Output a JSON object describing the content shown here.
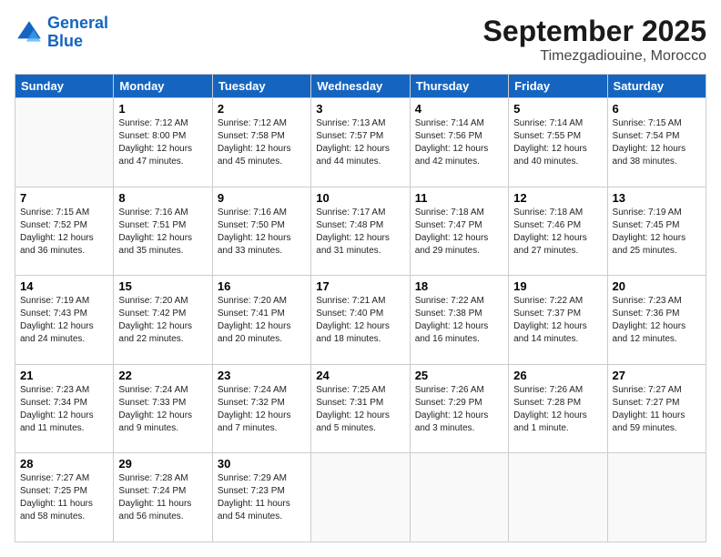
{
  "header": {
    "logo_line1": "General",
    "logo_line2": "Blue",
    "month": "September 2025",
    "location": "Timezgadiouine, Morocco"
  },
  "weekdays": [
    "Sunday",
    "Monday",
    "Tuesday",
    "Wednesday",
    "Thursday",
    "Friday",
    "Saturday"
  ],
  "weeks": [
    [
      {
        "day": "",
        "sunrise": "",
        "sunset": "",
        "daylight": ""
      },
      {
        "day": "1",
        "sunrise": "Sunrise: 7:12 AM",
        "sunset": "Sunset: 8:00 PM",
        "daylight": "Daylight: 12 hours and 47 minutes."
      },
      {
        "day": "2",
        "sunrise": "Sunrise: 7:12 AM",
        "sunset": "Sunset: 7:58 PM",
        "daylight": "Daylight: 12 hours and 45 minutes."
      },
      {
        "day": "3",
        "sunrise": "Sunrise: 7:13 AM",
        "sunset": "Sunset: 7:57 PM",
        "daylight": "Daylight: 12 hours and 44 minutes."
      },
      {
        "day": "4",
        "sunrise": "Sunrise: 7:14 AM",
        "sunset": "Sunset: 7:56 PM",
        "daylight": "Daylight: 12 hours and 42 minutes."
      },
      {
        "day": "5",
        "sunrise": "Sunrise: 7:14 AM",
        "sunset": "Sunset: 7:55 PM",
        "daylight": "Daylight: 12 hours and 40 minutes."
      },
      {
        "day": "6",
        "sunrise": "Sunrise: 7:15 AM",
        "sunset": "Sunset: 7:54 PM",
        "daylight": "Daylight: 12 hours and 38 minutes."
      }
    ],
    [
      {
        "day": "7",
        "sunrise": "Sunrise: 7:15 AM",
        "sunset": "Sunset: 7:52 PM",
        "daylight": "Daylight: 12 hours and 36 minutes."
      },
      {
        "day": "8",
        "sunrise": "Sunrise: 7:16 AM",
        "sunset": "Sunset: 7:51 PM",
        "daylight": "Daylight: 12 hours and 35 minutes."
      },
      {
        "day": "9",
        "sunrise": "Sunrise: 7:16 AM",
        "sunset": "Sunset: 7:50 PM",
        "daylight": "Daylight: 12 hours and 33 minutes."
      },
      {
        "day": "10",
        "sunrise": "Sunrise: 7:17 AM",
        "sunset": "Sunset: 7:48 PM",
        "daylight": "Daylight: 12 hours and 31 minutes."
      },
      {
        "day": "11",
        "sunrise": "Sunrise: 7:18 AM",
        "sunset": "Sunset: 7:47 PM",
        "daylight": "Daylight: 12 hours and 29 minutes."
      },
      {
        "day": "12",
        "sunrise": "Sunrise: 7:18 AM",
        "sunset": "Sunset: 7:46 PM",
        "daylight": "Daylight: 12 hours and 27 minutes."
      },
      {
        "day": "13",
        "sunrise": "Sunrise: 7:19 AM",
        "sunset": "Sunset: 7:45 PM",
        "daylight": "Daylight: 12 hours and 25 minutes."
      }
    ],
    [
      {
        "day": "14",
        "sunrise": "Sunrise: 7:19 AM",
        "sunset": "Sunset: 7:43 PM",
        "daylight": "Daylight: 12 hours and 24 minutes."
      },
      {
        "day": "15",
        "sunrise": "Sunrise: 7:20 AM",
        "sunset": "Sunset: 7:42 PM",
        "daylight": "Daylight: 12 hours and 22 minutes."
      },
      {
        "day": "16",
        "sunrise": "Sunrise: 7:20 AM",
        "sunset": "Sunset: 7:41 PM",
        "daylight": "Daylight: 12 hours and 20 minutes."
      },
      {
        "day": "17",
        "sunrise": "Sunrise: 7:21 AM",
        "sunset": "Sunset: 7:40 PM",
        "daylight": "Daylight: 12 hours and 18 minutes."
      },
      {
        "day": "18",
        "sunrise": "Sunrise: 7:22 AM",
        "sunset": "Sunset: 7:38 PM",
        "daylight": "Daylight: 12 hours and 16 minutes."
      },
      {
        "day": "19",
        "sunrise": "Sunrise: 7:22 AM",
        "sunset": "Sunset: 7:37 PM",
        "daylight": "Daylight: 12 hours and 14 minutes."
      },
      {
        "day": "20",
        "sunrise": "Sunrise: 7:23 AM",
        "sunset": "Sunset: 7:36 PM",
        "daylight": "Daylight: 12 hours and 12 minutes."
      }
    ],
    [
      {
        "day": "21",
        "sunrise": "Sunrise: 7:23 AM",
        "sunset": "Sunset: 7:34 PM",
        "daylight": "Daylight: 12 hours and 11 minutes."
      },
      {
        "day": "22",
        "sunrise": "Sunrise: 7:24 AM",
        "sunset": "Sunset: 7:33 PM",
        "daylight": "Daylight: 12 hours and 9 minutes."
      },
      {
        "day": "23",
        "sunrise": "Sunrise: 7:24 AM",
        "sunset": "Sunset: 7:32 PM",
        "daylight": "Daylight: 12 hours and 7 minutes."
      },
      {
        "day": "24",
        "sunrise": "Sunrise: 7:25 AM",
        "sunset": "Sunset: 7:31 PM",
        "daylight": "Daylight: 12 hours and 5 minutes."
      },
      {
        "day": "25",
        "sunrise": "Sunrise: 7:26 AM",
        "sunset": "Sunset: 7:29 PM",
        "daylight": "Daylight: 12 hours and 3 minutes."
      },
      {
        "day": "26",
        "sunrise": "Sunrise: 7:26 AM",
        "sunset": "Sunset: 7:28 PM",
        "daylight": "Daylight: 12 hours and 1 minute."
      },
      {
        "day": "27",
        "sunrise": "Sunrise: 7:27 AM",
        "sunset": "Sunset: 7:27 PM",
        "daylight": "Daylight: 11 hours and 59 minutes."
      }
    ],
    [
      {
        "day": "28",
        "sunrise": "Sunrise: 7:27 AM",
        "sunset": "Sunset: 7:25 PM",
        "daylight": "Daylight: 11 hours and 58 minutes."
      },
      {
        "day": "29",
        "sunrise": "Sunrise: 7:28 AM",
        "sunset": "Sunset: 7:24 PM",
        "daylight": "Daylight: 11 hours and 56 minutes."
      },
      {
        "day": "30",
        "sunrise": "Sunrise: 7:29 AM",
        "sunset": "Sunset: 7:23 PM",
        "daylight": "Daylight: 11 hours and 54 minutes."
      },
      {
        "day": "",
        "sunrise": "",
        "sunset": "",
        "daylight": ""
      },
      {
        "day": "",
        "sunrise": "",
        "sunset": "",
        "daylight": ""
      },
      {
        "day": "",
        "sunrise": "",
        "sunset": "",
        "daylight": ""
      },
      {
        "day": "",
        "sunrise": "",
        "sunset": "",
        "daylight": ""
      }
    ]
  ]
}
